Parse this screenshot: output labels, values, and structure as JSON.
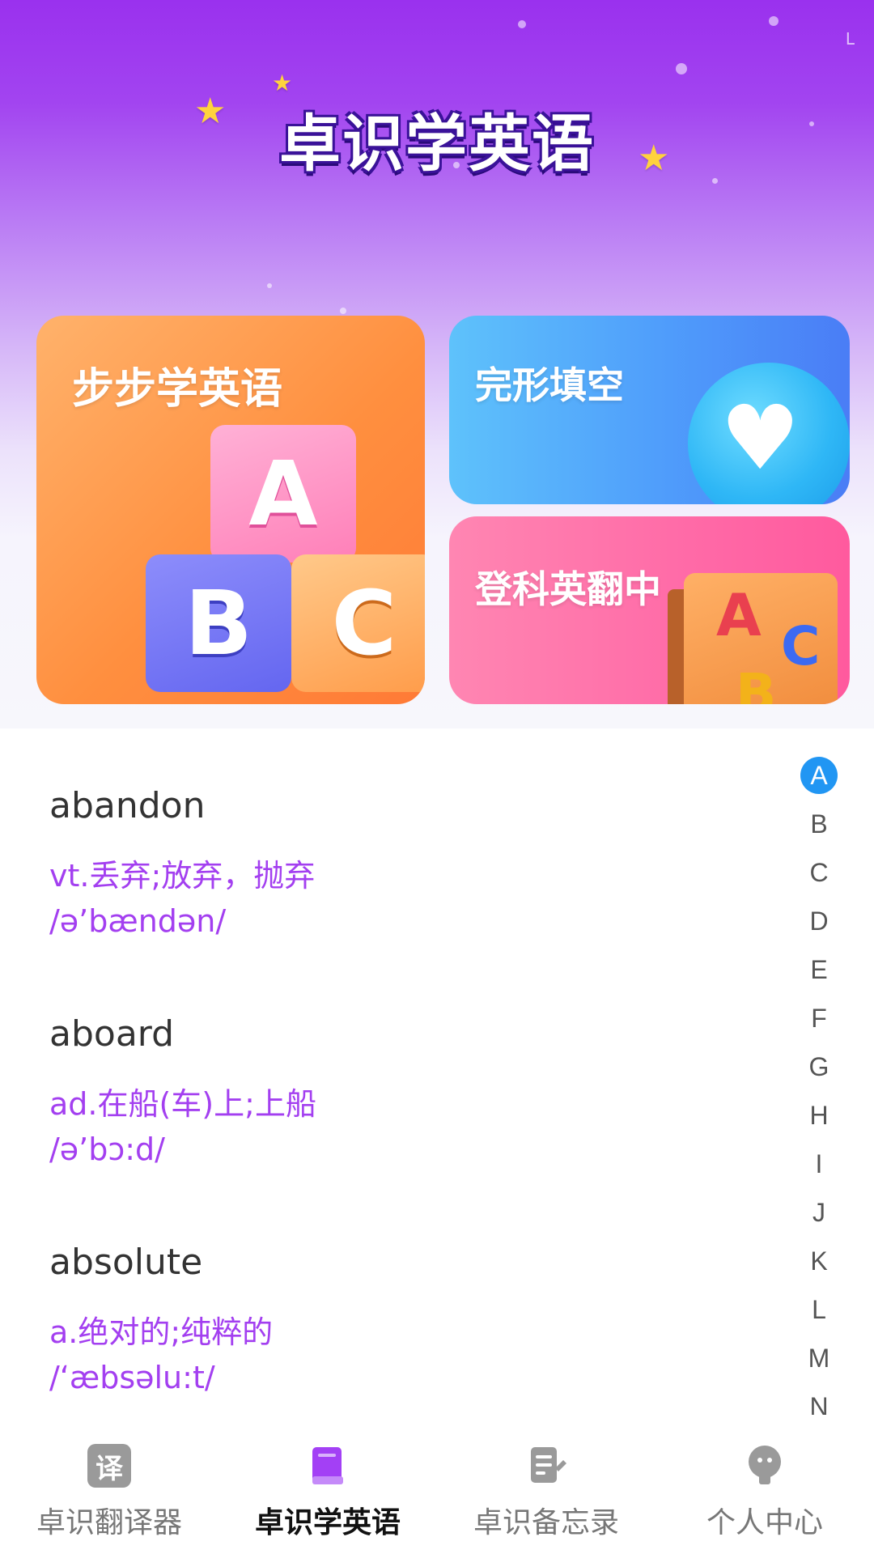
{
  "header": {
    "app_title": "卓识学英语",
    "corner_mark": "L"
  },
  "cards": [
    {
      "label": "步步学英语",
      "blocks": [
        "A",
        "B",
        "C"
      ]
    },
    {
      "label": "完形填空"
    },
    {
      "label": "登科英翻中",
      "scroll_letters": [
        "A",
        "C",
        "B"
      ]
    }
  ],
  "words": [
    {
      "word": "abandon",
      "meaning": "vt.丢弃;放弃，抛弃",
      "phonetic": "/ə’bændən/"
    },
    {
      "word": "aboard",
      "meaning": "ad.在船(车)上;上船",
      "phonetic": "/ə’bɔ:d/"
    },
    {
      "word": "absolute",
      "meaning": "a.绝对的;纯粹的",
      "phonetic": "/‘æbsəlu:t/"
    }
  ],
  "index_bar": {
    "active": "A",
    "letters": [
      "A",
      "B",
      "C",
      "D",
      "E",
      "F",
      "G",
      "H",
      "I",
      "J",
      "K",
      "L",
      "M",
      "N"
    ]
  },
  "bottom_nav": [
    {
      "label": "卓识翻译器",
      "icon": "translate-icon",
      "icon_glyph": "译",
      "active": false
    },
    {
      "label": "卓识学英语",
      "icon": "book-icon",
      "active": true
    },
    {
      "label": "卓识备忘录",
      "icon": "memo-icon",
      "active": false
    },
    {
      "label": "个人中心",
      "icon": "profile-icon",
      "active": false
    }
  ],
  "colors": {
    "accent_purple": "#a33ff0",
    "index_active": "#2196f3",
    "nav_active_icon": "#a340f5",
    "nav_inactive_icon": "#9a9a9a"
  }
}
